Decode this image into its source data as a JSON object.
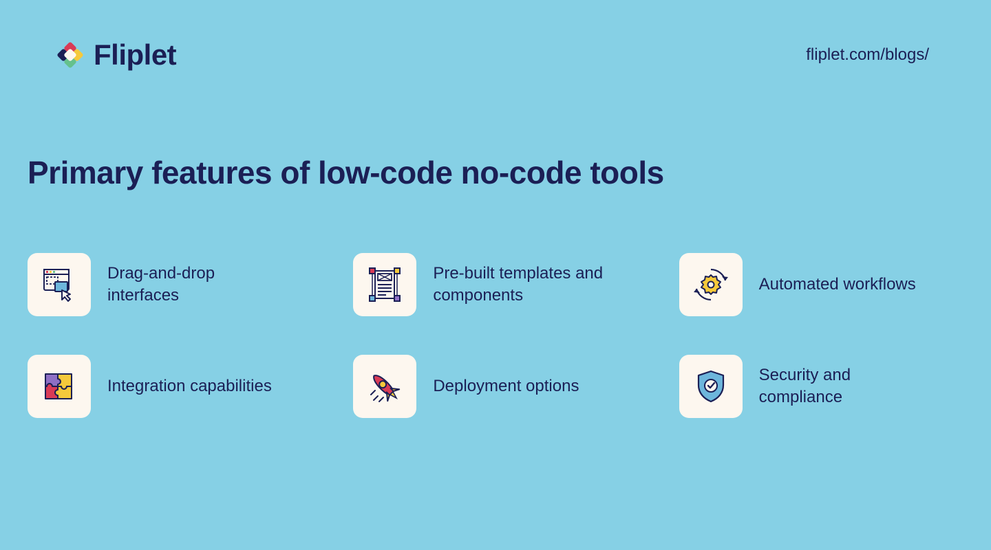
{
  "brand": {
    "name": "Fliplet"
  },
  "url": "fliplet.com/blogs/",
  "title": "Primary features of low-code no-code tools",
  "features": [
    {
      "label": "Drag-and-drop interfaces",
      "icon": "drag-drop-icon"
    },
    {
      "label": "Pre-built templates and components",
      "icon": "template-icon"
    },
    {
      "label": "Automated workflows",
      "icon": "workflow-icon"
    },
    {
      "label": "Integration capabilities",
      "icon": "puzzle-icon"
    },
    {
      "label": "Deployment options",
      "icon": "rocket-icon"
    },
    {
      "label": "Security and compliance",
      "icon": "shield-icon"
    }
  ],
  "colors": {
    "background": "#86d0e5",
    "text": "#1b1f55",
    "card": "#fdf7ef",
    "accentRed": "#d93b56",
    "accentYellow": "#f5c93b",
    "accentGreen": "#65c18c",
    "accentPurple": "#8e6fc5",
    "accentBlue": "#6db6dc"
  }
}
